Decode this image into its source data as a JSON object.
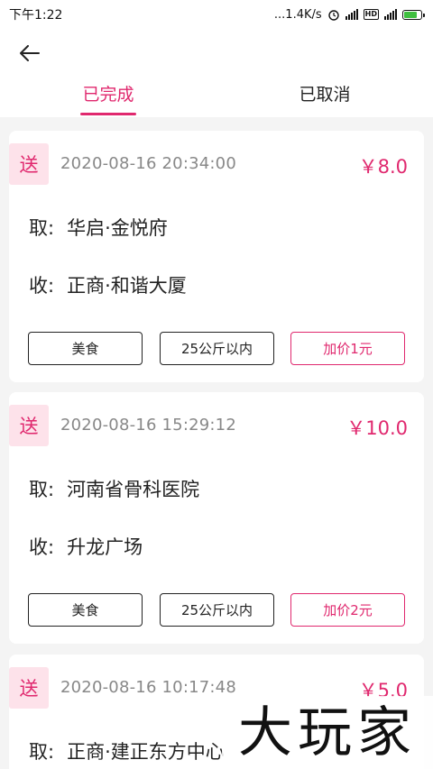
{
  "status_bar": {
    "time": "下午1:22",
    "speed": "...1.4K/s",
    "hd": "HD",
    "net": "4G"
  },
  "colors": {
    "accent": "#e0286e",
    "badge_bg": "#fde2ea",
    "page_bg": "#f4f4f4"
  },
  "header": {
    "back_icon": "arrow-left-icon"
  },
  "tabs": [
    {
      "label": "已完成",
      "active": true
    },
    {
      "label": "已取消",
      "active": false
    }
  ],
  "orders": [
    {
      "badge": "送",
      "time": "2020-08-16 20:34:00",
      "price": "￥8.0",
      "pickup_label": "取:",
      "pickup": "华启·金悦府",
      "receive_label": "收:",
      "receive": "正商·和谐大厦",
      "tags": [
        "美食",
        "25公斤以内",
        "加价1元"
      ]
    },
    {
      "badge": "送",
      "time": "2020-08-16 15:29:12",
      "price": "￥10.0",
      "pickup_label": "取:",
      "pickup": "河南省骨科医院",
      "receive_label": "收:",
      "receive": "升龙广场",
      "tags": [
        "美食",
        "25公斤以内",
        "加价2元"
      ]
    },
    {
      "badge": "送",
      "time": "2020-08-16 10:17:48",
      "price": "￥5.0",
      "pickup_label": "取:",
      "pickup": "正商·建正东方中心"
    }
  ],
  "watermark": "大玩家"
}
